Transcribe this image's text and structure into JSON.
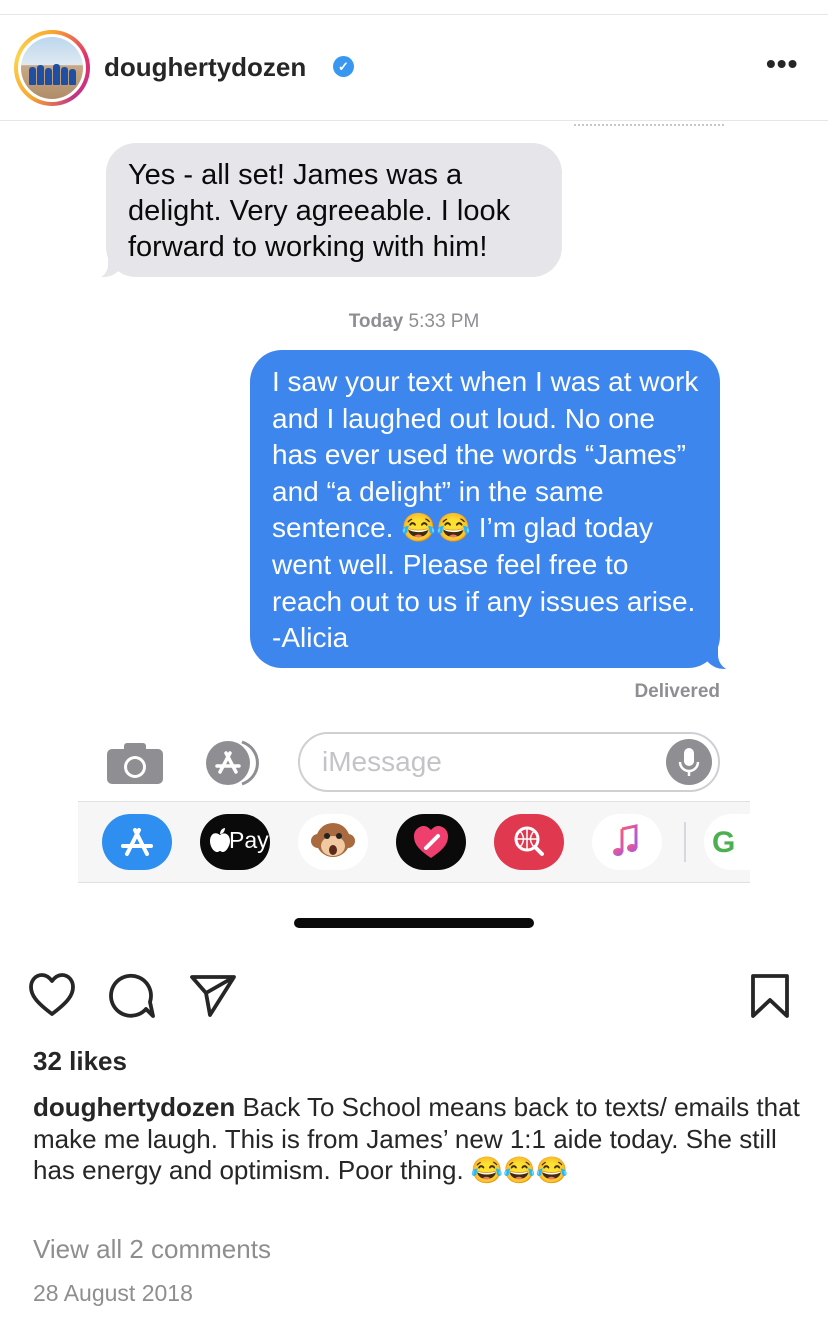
{
  "post": {
    "username": "doughertydozen",
    "verified_mark": "✓",
    "more_label": "•••"
  },
  "screenshot": {
    "incoming_message": "Yes - all set! James was a delight. Very agreeable. I look forward to working with him!",
    "timestamp_day": "Today",
    "timestamp_time": "5:33 PM",
    "outgoing_message": "I saw your text when I was at work and I laughed out loud. No one has ever used the words “James” and “a delight” in the same sentence. 😂😂 I’m glad today went well. Please feel free to reach out to us if any issues arise. -Alicia",
    "delivered_label": "Delivered",
    "input_placeholder": "iMessage",
    "apple_pay_label": "Pay",
    "tray_g_label": "G",
    "icons": [
      "camera-icon",
      "app-store-icon",
      "mic-icon",
      "app-store-tray-icon",
      "apple-pay-icon",
      "monkey-animoji-icon",
      "digital-touch-heart-icon",
      "web-search-icon",
      "music-icon",
      "g-app-icon"
    ]
  },
  "actions": {
    "icons": [
      "heart-icon",
      "comment-icon",
      "share-icon",
      "bookmark-icon"
    ]
  },
  "likes_text": "32 likes",
  "caption": {
    "username": "doughertydozen",
    "text": " Back To School means back to texts/ emails that make me laugh. This is from James’ new 1:1 aide today. She still has energy and optimism. Poor thing. 😂😂😂"
  },
  "view_comments": "View all 2 comments",
  "date": "28 August 2018",
  "colors": {
    "imessage_blue": "#3d86ed",
    "incoming_gray": "#e5e5ea",
    "verified_blue": "#3897f0",
    "secondary_text": "#8e8e8e"
  }
}
